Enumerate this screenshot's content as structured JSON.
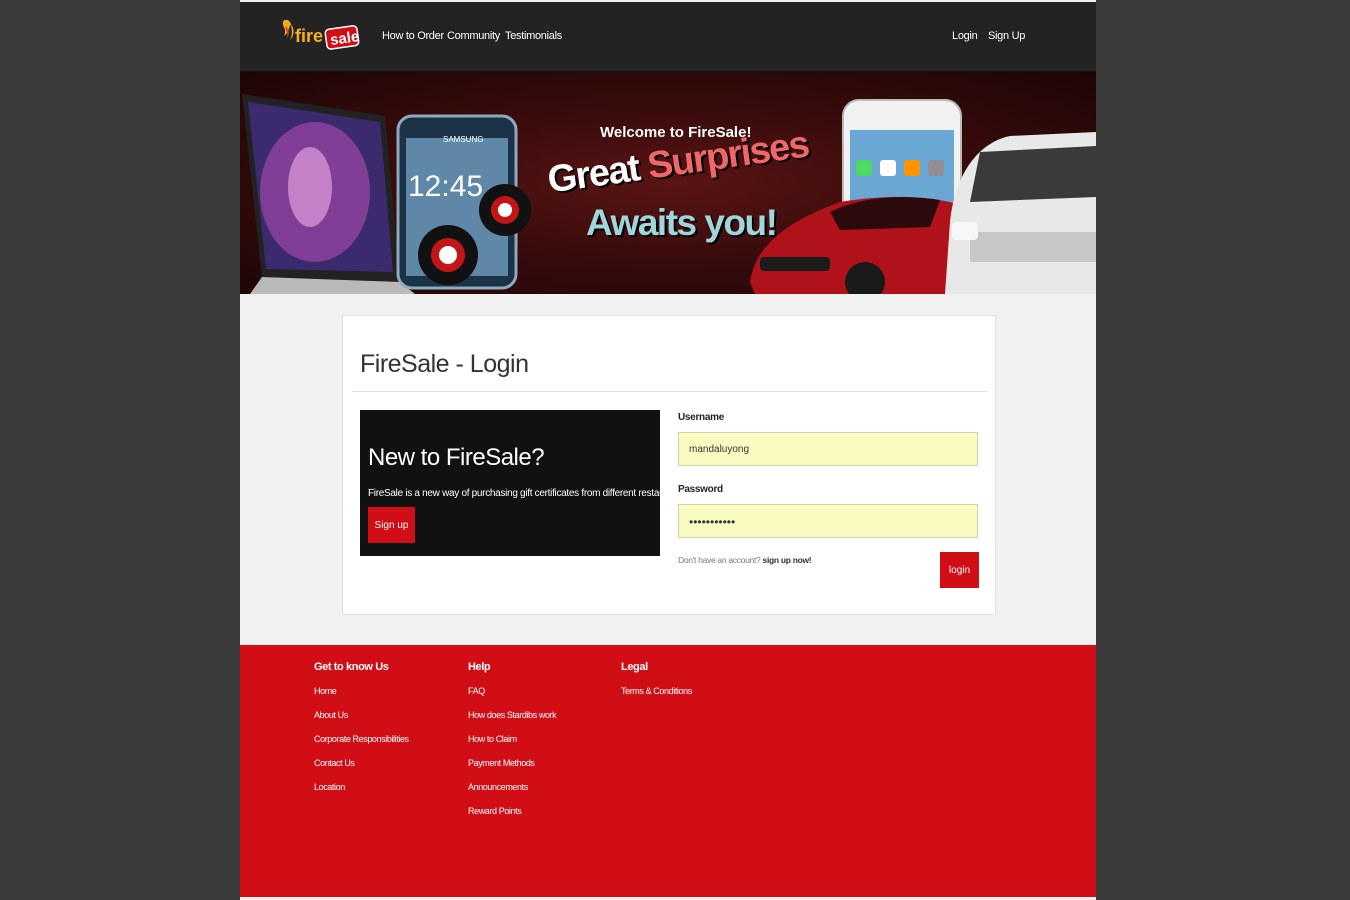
{
  "brand": {
    "logo_text_a": "fire",
    "logo_text_b": "sale"
  },
  "nav": {
    "left": [
      "How to Order",
      "Community",
      "Testimonials"
    ],
    "login": "Login",
    "signup": "Sign Up"
  },
  "banner": {
    "welcome": "Welcome to FireSale!",
    "great": "Great",
    "surprises": "Surprises",
    "awaits": "Awaits you!",
    "phone_time": "12:45",
    "phone_brand": "SAMSUNG"
  },
  "login_card": {
    "title": "FireSale - Login",
    "promo_heading": "New to FireSale?",
    "promo_text": "FireSale is a new way of purchasing gift certificates from different restaurants.",
    "promo_button": "Sign up",
    "username_label": "Username",
    "username_value": "mandaluyong",
    "password_label": "Password",
    "password_value": "•••••••••••",
    "no_account_text": "Don't have an account?",
    "signup_link": "sign up now!",
    "login_button": "login"
  },
  "footer": {
    "columns": [
      {
        "heading": "Get to know Us",
        "links": [
          "Home",
          "About Us",
          "Corporate Responsibilities",
          "Contact Us",
          "Location"
        ]
      },
      {
        "heading": "Help",
        "links": [
          "FAQ",
          "How does Stardibs work",
          "How to Claim",
          "Payment Methods",
          "Announcements",
          "Reward Points"
        ]
      },
      {
        "heading": "Legal",
        "links": [
          "Terms & Conditions"
        ]
      }
    ]
  },
  "colors": {
    "accent": "#d10d15",
    "navbar": "#232323",
    "input_bg": "#fafbc0"
  }
}
